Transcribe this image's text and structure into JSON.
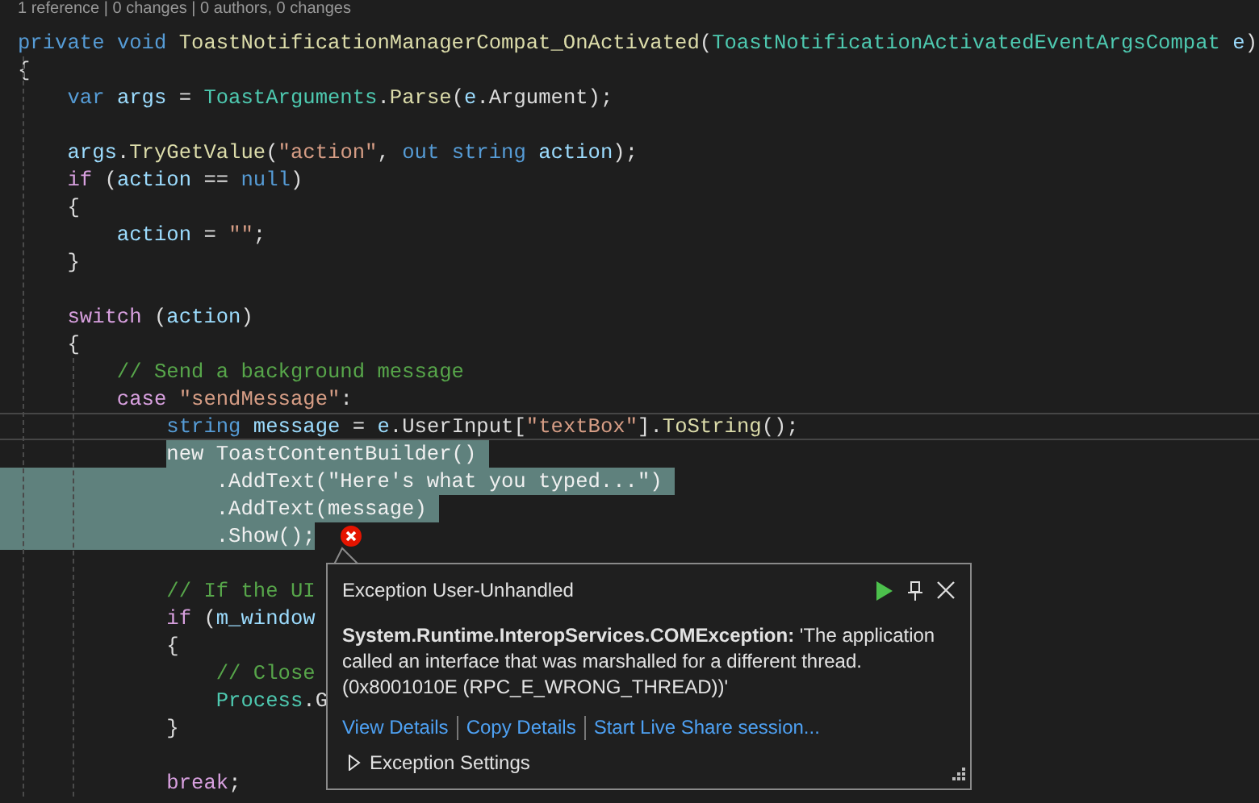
{
  "codelens": "1 reference | 0 changes | 0 authors, 0 changes",
  "editor": {
    "lines": [
      {
        "kind": "code",
        "tokens": [
          {
            "text": "private ",
            "kind": "kw"
          },
          {
            "text": "void ",
            "kind": "kw"
          },
          {
            "text": "ToastNotificationManagerCompat_OnActivated",
            "kind": "method"
          },
          {
            "text": "(",
            "kind": "plain"
          },
          {
            "text": "ToastNotificationActivatedEventArgsCompat ",
            "kind": "type"
          },
          {
            "text": "e",
            "kind": "var"
          },
          {
            "text": ")",
            "kind": "plain"
          }
        ],
        "selected": false,
        "current": false,
        "error": false
      },
      {
        "kind": "code",
        "tokens": [
          {
            "text": "{",
            "kind": "plain"
          }
        ],
        "selected": false,
        "current": false,
        "error": false
      },
      {
        "kind": "code",
        "tokens": [
          {
            "text": "    var ",
            "kind": "kw"
          },
          {
            "text": "args",
            "kind": "var"
          },
          {
            "text": " = ",
            "kind": "plain"
          },
          {
            "text": "ToastArguments",
            "kind": "type"
          },
          {
            "text": ".",
            "kind": "plain"
          },
          {
            "text": "Parse",
            "kind": "method"
          },
          {
            "text": "(",
            "kind": "plain"
          },
          {
            "text": "e",
            "kind": "var"
          },
          {
            "text": ".Argument);",
            "kind": "plain"
          }
        ],
        "selected": false,
        "current": false,
        "error": false
      },
      {
        "kind": "blank"
      },
      {
        "kind": "code",
        "tokens": [
          {
            "text": "    args",
            "kind": "var"
          },
          {
            "text": ".",
            "kind": "plain"
          },
          {
            "text": "TryGetValue",
            "kind": "method"
          },
          {
            "text": "(",
            "kind": "plain"
          },
          {
            "text": "\"action\"",
            "kind": "str"
          },
          {
            "text": ", ",
            "kind": "plain"
          },
          {
            "text": "out ",
            "kind": "kw"
          },
          {
            "text": "string ",
            "kind": "kw"
          },
          {
            "text": "action",
            "kind": "var"
          },
          {
            "text": ");",
            "kind": "plain"
          }
        ],
        "selected": false,
        "current": false,
        "error": false
      },
      {
        "kind": "code",
        "tokens": [
          {
            "text": "    if",
            "kind": "ctl"
          },
          {
            "text": " (",
            "kind": "plain"
          },
          {
            "text": "action",
            "kind": "var"
          },
          {
            "text": " == ",
            "kind": "plain"
          },
          {
            "text": "null",
            "kind": "kw"
          },
          {
            "text": ")",
            "kind": "plain"
          }
        ],
        "selected": false,
        "current": false,
        "error": false
      },
      {
        "kind": "code",
        "tokens": [
          {
            "text": "    {",
            "kind": "plain"
          }
        ],
        "selected": false,
        "current": false,
        "error": false
      },
      {
        "kind": "code",
        "tokens": [
          {
            "text": "        action",
            "kind": "var"
          },
          {
            "text": " = ",
            "kind": "plain"
          },
          {
            "text": "\"\"",
            "kind": "str"
          },
          {
            "text": ";",
            "kind": "plain"
          }
        ],
        "selected": false,
        "current": false,
        "error": false
      },
      {
        "kind": "code",
        "tokens": [
          {
            "text": "    }",
            "kind": "plain"
          }
        ],
        "selected": false,
        "current": false,
        "error": false
      },
      {
        "kind": "blank"
      },
      {
        "kind": "code",
        "tokens": [
          {
            "text": "    switch",
            "kind": "ctl"
          },
          {
            "text": " (",
            "kind": "plain"
          },
          {
            "text": "action",
            "kind": "var"
          },
          {
            "text": ")",
            "kind": "plain"
          }
        ],
        "selected": false,
        "current": false,
        "error": false
      },
      {
        "kind": "code",
        "tokens": [
          {
            "text": "    {",
            "kind": "plain"
          }
        ],
        "selected": false,
        "current": false,
        "error": false
      },
      {
        "kind": "code",
        "tokens": [
          {
            "text": "        // Send a background message",
            "kind": "comment"
          }
        ],
        "selected": false,
        "current": false,
        "error": false
      },
      {
        "kind": "code",
        "tokens": [
          {
            "text": "        case ",
            "kind": "ctl"
          },
          {
            "text": "\"sendMessage\"",
            "kind": "str"
          },
          {
            "text": ":",
            "kind": "plain"
          }
        ],
        "selected": false,
        "current": false,
        "error": false
      },
      {
        "kind": "code",
        "tokens": [
          {
            "text": "            string ",
            "kind": "kw"
          },
          {
            "text": "message",
            "kind": "var"
          },
          {
            "text": " = ",
            "kind": "plain"
          },
          {
            "text": "e",
            "kind": "var"
          },
          {
            "text": ".UserInput[",
            "kind": "plain"
          },
          {
            "text": "\"textBox\"",
            "kind": "str"
          },
          {
            "text": "].",
            "kind": "plain"
          },
          {
            "text": "ToString",
            "kind": "method"
          },
          {
            "text": "();",
            "kind": "plain"
          }
        ],
        "selected": false,
        "current": true,
        "error": false
      },
      {
        "kind": "code",
        "tokens": [
          {
            "text": "            new ToastContentBuilder() ",
            "kind": "plain"
          }
        ],
        "selected": true,
        "current": false,
        "error": false
      },
      {
        "kind": "code",
        "tokens": [
          {
            "text": "                .AddText(\"Here's what you typed...\") ",
            "kind": "plain"
          }
        ],
        "selected": true,
        "current": false,
        "error": false
      },
      {
        "kind": "code",
        "tokens": [
          {
            "text": "                .AddText(message) ",
            "kind": "plain"
          }
        ],
        "selected": true,
        "current": false,
        "error": false
      },
      {
        "kind": "code",
        "tokens": [
          {
            "text": "                .Show();",
            "kind": "plain"
          }
        ],
        "selected": true,
        "current": false,
        "error": true
      },
      {
        "kind": "blank"
      },
      {
        "kind": "code",
        "tokens": [
          {
            "text": "            // If the UI",
            "kind": "comment"
          }
        ],
        "selected": false,
        "current": false,
        "error": false
      },
      {
        "kind": "code",
        "tokens": [
          {
            "text": "            if",
            "kind": "ctl"
          },
          {
            "text": " (",
            "kind": "plain"
          },
          {
            "text": "m_window",
            "kind": "var"
          }
        ],
        "selected": false,
        "current": false,
        "error": false
      },
      {
        "kind": "code",
        "tokens": [
          {
            "text": "            {",
            "kind": "plain"
          }
        ],
        "selected": false,
        "current": false,
        "error": false
      },
      {
        "kind": "code",
        "tokens": [
          {
            "text": "                // Close",
            "kind": "comment"
          }
        ],
        "selected": false,
        "current": false,
        "error": false
      },
      {
        "kind": "code",
        "tokens": [
          {
            "text": "                Process",
            "kind": "type"
          },
          {
            "text": ".G",
            "kind": "plain"
          }
        ],
        "selected": false,
        "current": false,
        "error": false
      },
      {
        "kind": "code",
        "tokens": [
          {
            "text": "            }",
            "kind": "plain"
          }
        ],
        "selected": false,
        "current": false,
        "error": false
      },
      {
        "kind": "blank"
      },
      {
        "kind": "code",
        "tokens": [
          {
            "text": "            break",
            "kind": "ctl"
          },
          {
            "text": ";",
            "kind": "plain"
          }
        ],
        "selected": false,
        "current": false,
        "error": false
      }
    ]
  },
  "exception_popup": {
    "title": "Exception User-Unhandled",
    "message": "**System.Runtime.InteropServices.COMException:** 'The application called an interface that was marshalled for a different thread. (0x8001010E (RPC_E_WRONG_THREAD))'",
    "links": [
      "View Details",
      "Copy Details",
      "Start Live Share session..."
    ],
    "settings": {
      "label": "Exception Settings",
      "expanded": false
    }
  }
}
